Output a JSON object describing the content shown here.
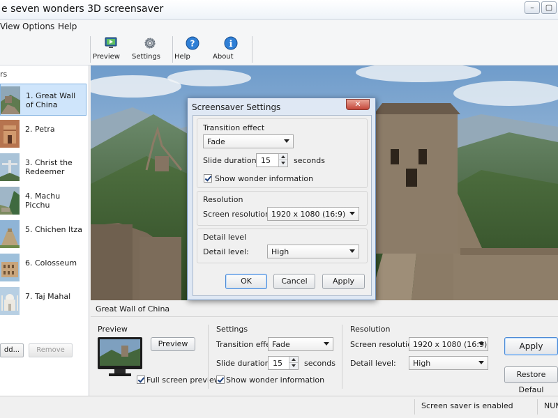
{
  "window": {
    "title": "e seven wonders 3D screensaver",
    "minimize_glyph": "–",
    "maximize_glyph": "▢",
    "close_glyph": "✕"
  },
  "menu": {
    "items": [
      "View",
      "Options",
      "Help"
    ]
  },
  "toolbar": {
    "buttons": [
      {
        "label": "Preview",
        "icon": "monitor-preview-icon"
      },
      {
        "label": "Settings",
        "icon": "gear-icon"
      },
      {
        "label": "Help",
        "icon": "help-icon"
      },
      {
        "label": "About",
        "icon": "info-icon"
      }
    ]
  },
  "sidebar": {
    "title": "rs",
    "items": [
      {
        "label": "1. Great Wall of China",
        "selected": true
      },
      {
        "label": "2. Petra"
      },
      {
        "label": "3. Christ the Redeemer"
      },
      {
        "label": "4. Machu Picchu"
      },
      {
        "label": "5. Chichen Itza"
      },
      {
        "label": "6. Colosseum"
      },
      {
        "label": "7. Taj Mahal"
      }
    ],
    "add_label": "dd...",
    "remove_label": "Remove"
  },
  "preview": {
    "caption": "Great Wall of China"
  },
  "bottom": {
    "preview_title": "Preview",
    "preview_button": "Preview",
    "full_screen_label": "Full screen preview",
    "full_screen_checked": true,
    "settings_title": "Settings",
    "transition_label": "Transition effect:",
    "transition_value": "Fade",
    "duration_label": "Slide duration:",
    "duration_value": "15",
    "duration_unit": "seconds",
    "show_info_label": "Show wonder information",
    "show_info_checked": true,
    "resolution_title": "Resolution",
    "screen_res_label": "Screen resolution:",
    "screen_res_value": "1920 x 1080 (16:9)",
    "detail_label": "Detail level:",
    "detail_value": "High",
    "apply_label": "Apply",
    "restore_label": "Restore Defaul"
  },
  "status": {
    "message": "Screen saver is enabled",
    "num": "NUM"
  },
  "dialog": {
    "title": "Screensaver Settings",
    "close_glyph": "✕",
    "transition_group": "Transition effect",
    "transition_value": "Fade",
    "duration_label": "Slide duration",
    "duration_value": "15",
    "duration_unit": "seconds",
    "show_info_label": "Show wonder information",
    "resolution_group": "Resolution",
    "screen_res_label": "Screen resolution:",
    "screen_res_value": "1920 x 1080 (16:9)",
    "detail_group": "Detail level",
    "detail_label": "Detail level:",
    "detail_value": "High",
    "ok_label": "OK",
    "cancel_label": "Cancel",
    "apply_label": "Apply"
  }
}
